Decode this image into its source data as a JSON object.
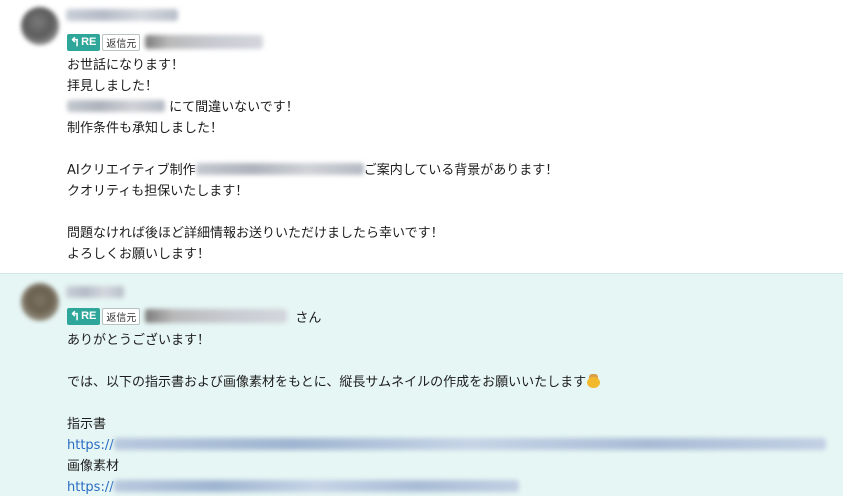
{
  "messages": [
    {
      "re_badge": "RE",
      "re_source": "返信元",
      "body_before_blank": [
        "お世話になります！",
        "拝見しました！"
      ],
      "line3_suffix": "にて間違いないです！",
      "line4": "制作条件も承知しました！",
      "line5_prefix": "AIクリエイティブ制作",
      "line5_suffix": "ご案内している背景があります！",
      "line6": "クオリティも担保いたします！",
      "line7": "問題なければ後ほど詳細情報お送りいただけましたら幸いです！",
      "line8": "よろしくお願いします！"
    },
    {
      "re_badge": "RE",
      "re_source": "返信元",
      "reply_suffix": "さん",
      "line1": "ありがとうございます！",
      "line2": "では、以下の指示書および画像素材をもとに、縦長サムネイルの作成をお願いいたします",
      "label1": "指示書",
      "link1_prefix": "https://",
      "label2": "画像素材",
      "link2_prefix": "https://"
    }
  ],
  "colors": {
    "re_badge": "#2fa69a",
    "highlight_background": "#e6f6f4",
    "link": "#2b6cc4"
  },
  "icons": {
    "re_arrow": "reply-arrow-icon",
    "emoji": "bowing-emoji-icon"
  }
}
